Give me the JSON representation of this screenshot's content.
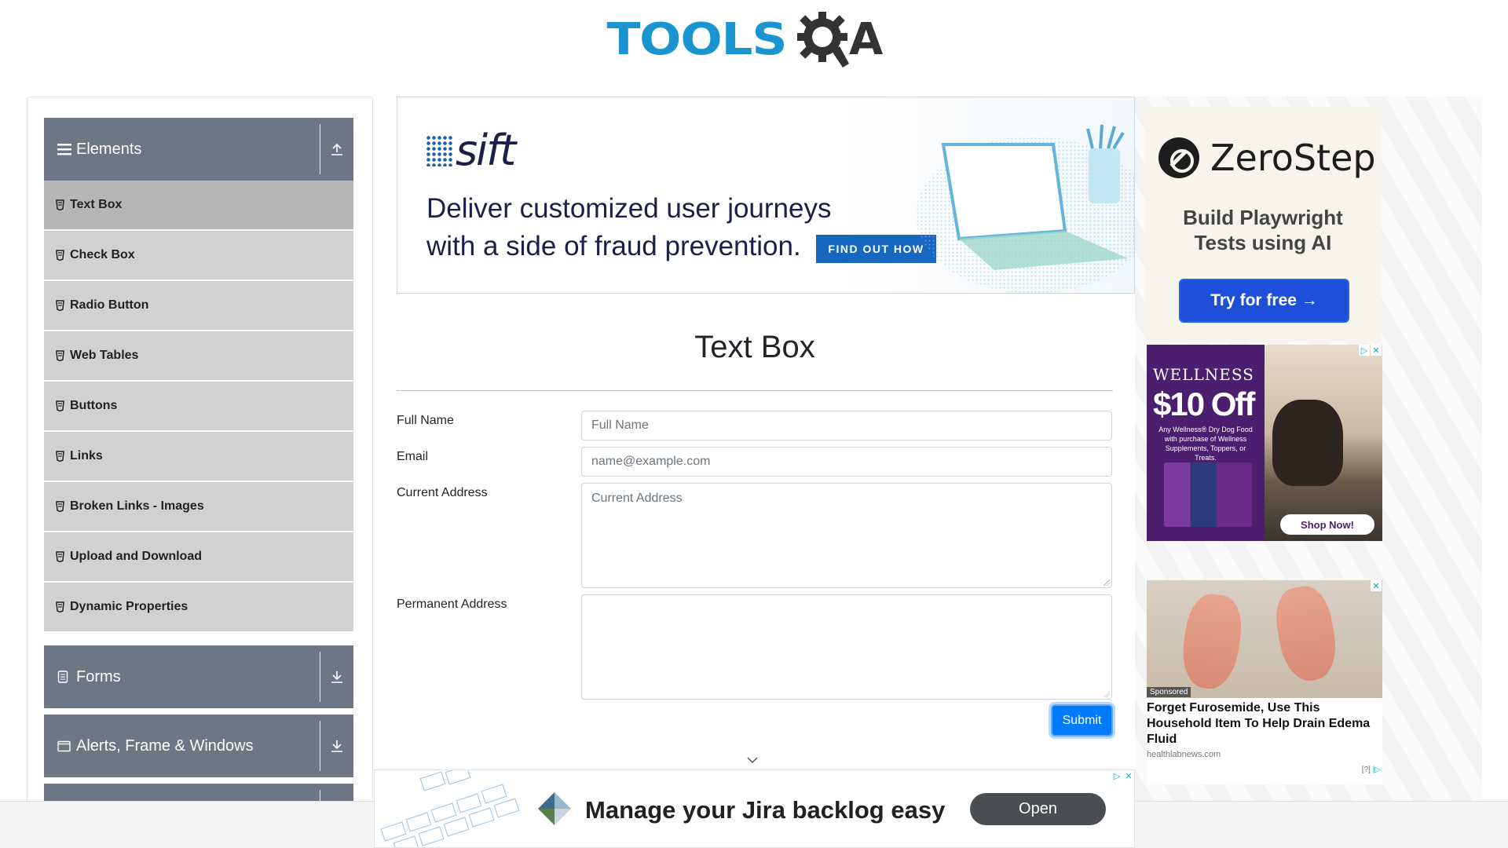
{
  "logo": {
    "part1": "TOOLS",
    "part2": "A"
  },
  "sidebar": {
    "groups": [
      {
        "label": "Elements",
        "icon": "hamburger-icon",
        "arrow": "collapse-up-icon"
      },
      {
        "label": "Forms",
        "icon": "document-icon",
        "arrow": "expand-down-icon"
      },
      {
        "label": "Alerts, Frame & Windows",
        "icon": "window-icon",
        "arrow": "expand-down-icon"
      }
    ],
    "items": [
      {
        "label": "Text Box",
        "active": true
      },
      {
        "label": "Check Box"
      },
      {
        "label": "Radio Button"
      },
      {
        "label": "Web Tables"
      },
      {
        "label": "Buttons"
      },
      {
        "label": "Links"
      },
      {
        "label": "Broken Links - Images"
      },
      {
        "label": "Upload and Download"
      },
      {
        "label": "Dynamic Properties"
      }
    ]
  },
  "ad_top": {
    "brand": "sift",
    "headline_line1": "Deliver customized user journeys",
    "headline_line2": "with a side of fraud prevention.",
    "cta": "FIND OUT HOW"
  },
  "form": {
    "title": "Text Box",
    "full_name_label": "Full Name",
    "full_name_placeholder": "Full Name",
    "email_label": "Email",
    "email_placeholder": "name@example.com",
    "current_address_label": "Current Address",
    "current_address_placeholder": "Current Address",
    "permanent_address_label": "Permanent Address",
    "permanent_address_placeholder": "",
    "submit_label": "Submit"
  },
  "ad_zerostep": {
    "brand": "ZeroStep",
    "tagline_line1": "Build Playwright",
    "tagline_line2": "Tests using AI",
    "cta": "Try for free →"
  },
  "ad_wellness": {
    "brand": "WELLNESS",
    "offer": "$10 Off",
    "fine_print": "Any Wellness® Dry Dog Food with purchase of Wellness Supplements, Toppers, or Treats.",
    "cta": "Shop Now!"
  },
  "ad_edema": {
    "badge": "Sponsored",
    "title": "Forget Furosemide, Use This Household Item To Help Drain Edema Fluid",
    "source": "healthlabnews.com",
    "ad_marker": "[?]"
  },
  "ad_bottom": {
    "text": "Manage your Jira backlog easy",
    "cta": "Open"
  },
  "colors": {
    "accent_blue": "#007bff",
    "sidebar_group": "#6c7684",
    "sidebar_item": "#d1d1d1",
    "sidebar_active": "#b6b6b6",
    "logo_blue": "#1a95d0"
  }
}
